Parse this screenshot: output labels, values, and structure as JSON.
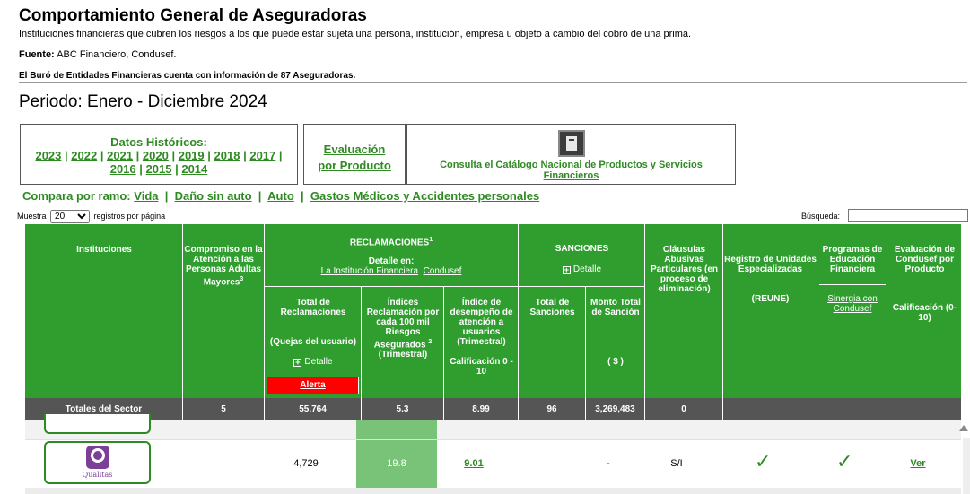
{
  "header": {
    "title": "Comportamiento General de Aseguradoras",
    "subtitle": "Instituciones financieras que cubren los riesgos a los que puede estar sujeta una persona, institución, empresa u objeto a cambio del cobro de una prima.",
    "source_label": "Fuente:",
    "source_value": "ABC Financiero, Condusef.",
    "buro_note": "El Buró de Entidades Financieras cuenta con información de 87 Aseguradoras.",
    "periodo": "Periodo: Enero - Diciembre 2024"
  },
  "historicos": {
    "title": "Datos Históricos:",
    "years": [
      "2023",
      "2022",
      "2021",
      "2020",
      "2019",
      "2018",
      "2017",
      "2016",
      "2015",
      "2014"
    ],
    "separator": "|"
  },
  "evaluacion": {
    "line1": "Evaluación",
    "line2": "por Producto"
  },
  "catalogo": {
    "link": "Consulta el Catálogo Nacional de Productos y Servicios Financieros"
  },
  "compara": {
    "label": "Compara por ramo:",
    "items": [
      "Vida",
      "Daño sin auto",
      "Auto",
      "Gastos Médicos y Accidentes personales"
    ],
    "separator": "|"
  },
  "controls": {
    "muestra_label": "Muestra",
    "page_size": "20",
    "registros_label": "registros por página",
    "busqueda_label": "Búsqueda:"
  },
  "table": {
    "headers": {
      "instituciones": "Instituciones",
      "compromiso": "Compromiso en la Atención a las Personas Adultas Mayores",
      "compromiso_sup": "3",
      "reclamaciones": "RECLAMACIONES",
      "reclamaciones_sup": "1",
      "detalle_en": "Detalle en:",
      "link_institucion": "La Institución Financiera",
      "link_condusef": "Condusef",
      "total_reclamaciones": "Total de Reclamaciones",
      "quejas": "(Quejas del usuario)",
      "detalle": "Detalle",
      "alerta": "Alerta",
      "indices": "Índices Reclamación por cada 100 mil Riesgos Asegurados",
      "indices_sup": "2",
      "indices_trim": "(Trimestral)",
      "indice_desempeno": "Índice de desempeño de atención a usuarios (Trimestral)",
      "calificacion_010": "Calificación 0 - 10",
      "sanciones": "SANCIONES",
      "total_sanciones": "Total de Sanciones",
      "monto_total": "Monto Total de Sanción",
      "monto_unit": "( $ )",
      "clausulas": "Cláusulas Abusivas Particulares (en proceso de eliminación)",
      "registro": "Registro de Unidades Especializadas",
      "reune": "(REUNE)",
      "programas": "Programas de Educación Financiera",
      "sinergia": "Sinergia con Condusef",
      "evaluacion": "Evaluación de Condusef por Producto",
      "calificacion": "Calificación (0-10)"
    },
    "totals": {
      "label": "Totales del Sector",
      "compromiso": "5",
      "total_reclamaciones": "55,764",
      "indices": "5.3",
      "indice_desempeno": "8.99",
      "total_sanciones": "96",
      "monto_total": "3,269,483",
      "clausulas": "0"
    },
    "rows": [
      {
        "institucion": "Qualitas",
        "total_reclamaciones": "4,729",
        "indices": "19.8",
        "indice_desempeno": "9.01",
        "monto_total": "-",
        "clausulas": "S/I",
        "registro_icon": "check-icon",
        "programas_icon": "check-icon",
        "evaluacion_link": "Ver"
      }
    ]
  },
  "colors": {
    "brand_green": "#2e8b22",
    "header_green": "#2f9e2f",
    "totals_gray": "#555555",
    "highlight_green": "#79c379",
    "alert_red": "#ff0000",
    "qualitas_purple": "#7b3f98"
  }
}
